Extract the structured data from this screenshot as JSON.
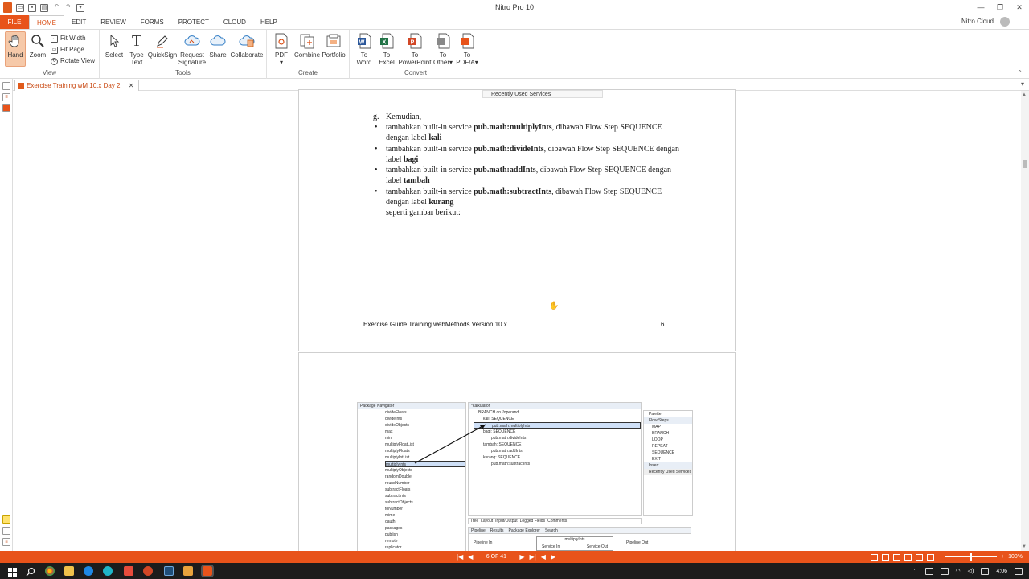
{
  "window": {
    "title": "Nitro Pro 10"
  },
  "ribbon": {
    "tabs": [
      "FILE",
      "HOME",
      "EDIT",
      "REVIEW",
      "FORMS",
      "PROTECT",
      "CLOUD",
      "HELP"
    ],
    "account_label": "Nitro Cloud",
    "groups": {
      "view": {
        "label": "View",
        "hand": "Hand",
        "zoom": "Zoom",
        "fit_width": "Fit Width",
        "fit_page": "Fit Page",
        "rotate_view": "Rotate View"
      },
      "tools": {
        "label": "Tools",
        "select": "Select",
        "type_text_1": "Type",
        "type_text_2": "Text",
        "quicksign": "QuickSign",
        "request_signature_1": "Request",
        "request_signature_2": "Signature",
        "share": "Share",
        "collaborate": "Collaborate"
      },
      "create": {
        "label": "Create",
        "pdf": "PDF",
        "combine": "Combine",
        "portfolio": "Portfolio"
      },
      "convert": {
        "label": "Convert",
        "to": "To",
        "word": "Word",
        "excel": "Excel",
        "powerpoint": "PowerPoint",
        "other": "Other",
        "pdfa": "PDF/A"
      }
    }
  },
  "document_tab": {
    "title": "Exercise Training wM 10.x Day 2"
  },
  "page1": {
    "top_snippet": "Recently Used Services",
    "g_marker": "g.",
    "intro": "Kemudian,",
    "bullets": [
      {
        "pre": "tambahkan built-in service ",
        "bold": "pub.math:multiplyInts",
        "post": ", dibawah Flow Step SEQUENCE",
        "line2_pre": "dengan label ",
        "line2_bold": "kali"
      },
      {
        "pre": "tambahkan built-in service ",
        "bold": "pub.math:divideInts",
        "post": ", dibawah Flow Step SEQUENCE dengan",
        "line2_pre": "label ",
        "line2_bold": "bagi"
      },
      {
        "pre": "tambahkan built-in service ",
        "bold": "pub.math:addInts",
        "post": ", dibawah Flow Step SEQUENCE dengan",
        "line2_pre": "label ",
        "line2_bold": "tambah"
      },
      {
        "pre": "tambahkan built-in service ",
        "bold": "pub.math:subtractInts",
        "post": ", dibawah Flow Step SEQUENCE",
        "line2_pre": "dengan label ",
        "line2_bold": "kurang"
      }
    ],
    "outro": "seperti gambar berikut:",
    "footer_text": "Exercise Guide Training webMethods Version 10.x",
    "footer_page": "6"
  },
  "page2": {
    "package_navigator": {
      "title": "Package Navigator",
      "items": [
        "divideFloats",
        "divideInts",
        "divideObjects",
        "max",
        "min",
        "multiplyFloatList",
        "multiplyFloats",
        "multiplyIntList",
        "multiplyInts",
        "multiplyObjects",
        "randomDouble",
        "roundNumber",
        "subtractFloats",
        "subtractInts",
        "subtractObjects",
        "toNumber",
        "mime",
        "oauth",
        "packages",
        "publish",
        "remote",
        "replicator"
      ],
      "selected": "multiplyInts"
    },
    "editor": {
      "title": "*kalkulator",
      "rows": [
        "BRANCH on '/operand'",
        "kali: SEQUENCE",
        "pub.math:multiplyInts",
        "bagi: SEQUENCE",
        "pub.math:divideInts",
        "tambah: SEQUENCE",
        "pub.math:addInts",
        "kurang: SEQUENCE",
        "pub.math:subtractInts"
      ],
      "tabs": [
        "Tree",
        "Layout",
        "Input/Output",
        "Logged Fields",
        "Comments"
      ],
      "bottom_tabs": [
        "Pipeline",
        "Results",
        "Package Explorer",
        "Search"
      ],
      "pipeline_in": "Pipeline In",
      "service_in": "Service In",
      "service_name": "multiplyInts",
      "service_out": "Service Out",
      "pipeline_out": "Pipeline Out"
    },
    "palette": {
      "title": "Palette",
      "section": "Flow Steps",
      "items": [
        "MAP",
        "BRANCH",
        "LOOP",
        "REPEAT",
        "SEQUENCE",
        "EXIT"
      ],
      "insert": "Insert",
      "recent": "Recently Used Services"
    }
  },
  "statusbar": {
    "page_indicator": "6 OF 41",
    "zoom": "100%"
  },
  "taskbar": {
    "time": "4:06"
  }
}
